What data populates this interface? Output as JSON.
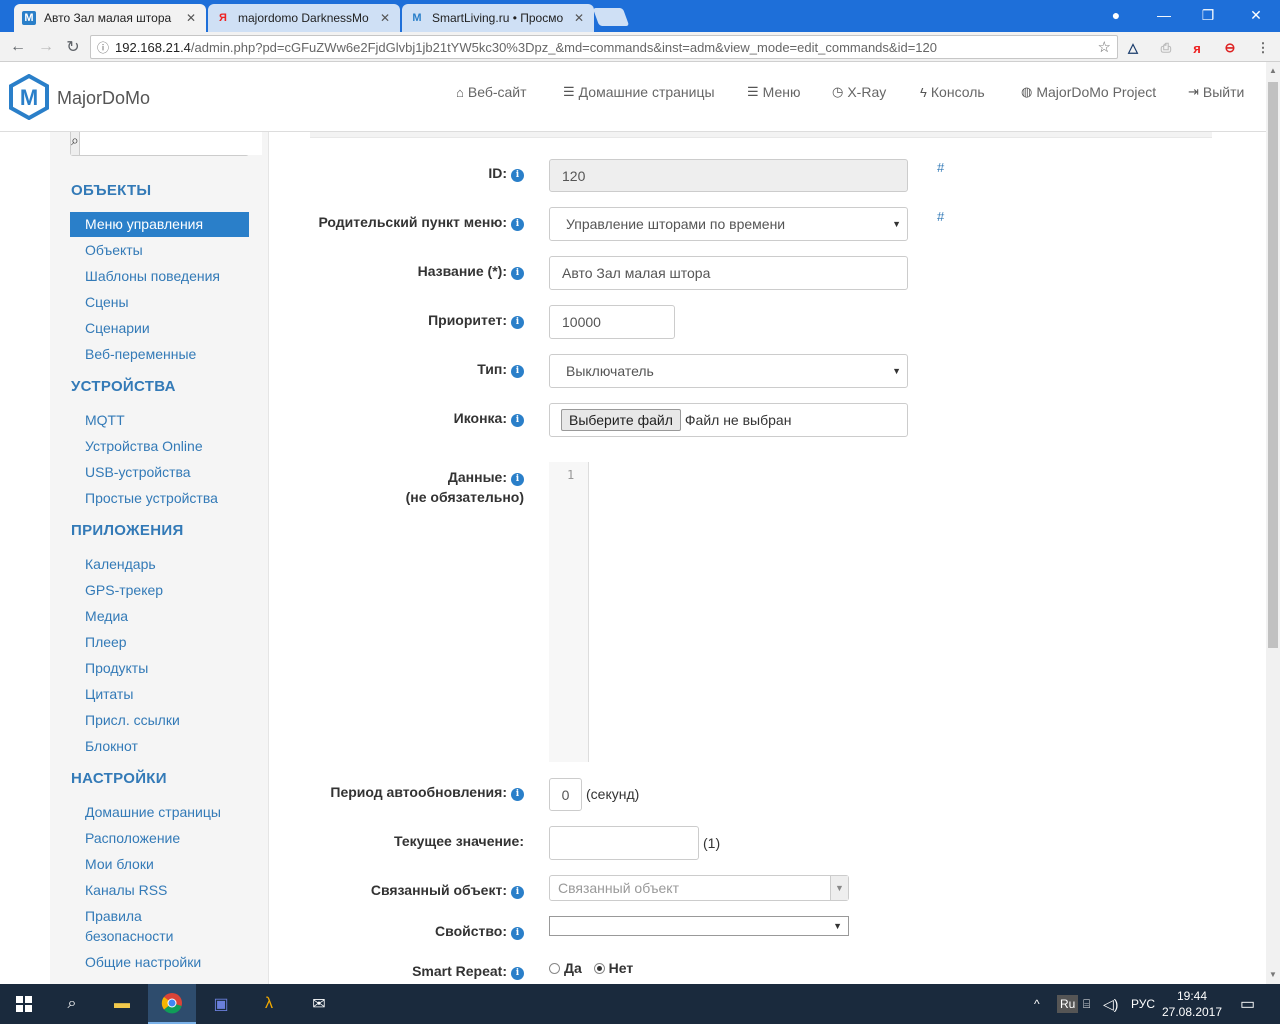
{
  "browser": {
    "tabs": [
      {
        "title": "Авто Зал малая штора",
        "favicon": "M",
        "active": true
      },
      {
        "title": "majordomo DarknessMo",
        "favicon": "Я",
        "active": false
      },
      {
        "title": "SmartLiving.ru • Просмо",
        "favicon": "M",
        "active": false
      }
    ],
    "url_host": "192.168.21.4",
    "url_rest": "/admin.php?pd=cGFuZWw6e2FjdGlvbj1jb21tYW5kc30%3Dpz_&md=commands&inst=adm&view_mode=edit_commands&id=120"
  },
  "header": {
    "brand": "MajorDoMo",
    "nav": [
      {
        "icon": "home-icon",
        "label": "Веб-сайт"
      },
      {
        "icon": "list-icon",
        "label": "Домашние страницы"
      },
      {
        "icon": "menu-icon",
        "label": "Меню"
      },
      {
        "icon": "clock-icon",
        "label": "X-Ray"
      },
      {
        "icon": "bolt-icon",
        "label": "Консоль"
      },
      {
        "icon": "globe-icon",
        "label": "MajorDoMo Project"
      },
      {
        "icon": "logout-icon",
        "label": "Выйти"
      }
    ]
  },
  "sidebar": {
    "search_value": "",
    "sections": [
      {
        "title": "ОБЪЕКТЫ",
        "items": [
          "Меню управления",
          "Объекты",
          "Шаблоны поведения",
          "Сцены",
          "Сценарии",
          "Веб-переменные"
        ]
      },
      {
        "title": "УСТРОЙСТВА",
        "items": [
          "MQTT",
          "Устройства Online",
          "USB-устройства",
          "Простые устройства"
        ]
      },
      {
        "title": "ПРИЛОЖЕНИЯ",
        "items": [
          "Календарь",
          "GPS-трекер",
          "Медиа",
          "Плеер",
          "Продукты",
          "Цитаты",
          "Присл. ссылки",
          "Блокнот"
        ]
      },
      {
        "title": "НАСТРОЙКИ",
        "items": [
          "Домашние страницы",
          "Расположение",
          "Мои блоки",
          "Каналы RSS",
          "Правила",
          "безопасности",
          "Общие настройки"
        ]
      }
    ],
    "active_item": "Меню управления"
  },
  "form": {
    "id_label": "ID:",
    "id_value": "120",
    "parent_label": "Родительский пункт меню:",
    "parent_value": "Управление шторами по времени",
    "name_label": "Название (*):",
    "name_value": "Авто Зал малая штора",
    "priority_label": "Приоритет:",
    "priority_value": "10000",
    "type_label": "Тип:",
    "type_value": "Выключатель",
    "icon_label": "Иконка:",
    "file_button": "Выберите файл",
    "file_status": "Файл не выбран",
    "data_label": "Данные:",
    "data_sub": "(не обязательно)",
    "data_line": "1",
    "refresh_label": "Период автообновления:",
    "refresh_value": "0",
    "refresh_unit": "(секунд)",
    "current_label": "Текущее значение:",
    "current_value": "",
    "current_note": "(1)",
    "linked_label": "Связанный объект:",
    "linked_placeholder": "Связанный объект",
    "property_label": "Свойство:",
    "property_value": "",
    "smart_label": "Smart Repeat:",
    "smart_yes": "Да",
    "smart_no": "Нет",
    "hash": "#"
  },
  "taskbar": {
    "lang": "РУС",
    "time": "19:44",
    "date": "27.08.2017"
  }
}
